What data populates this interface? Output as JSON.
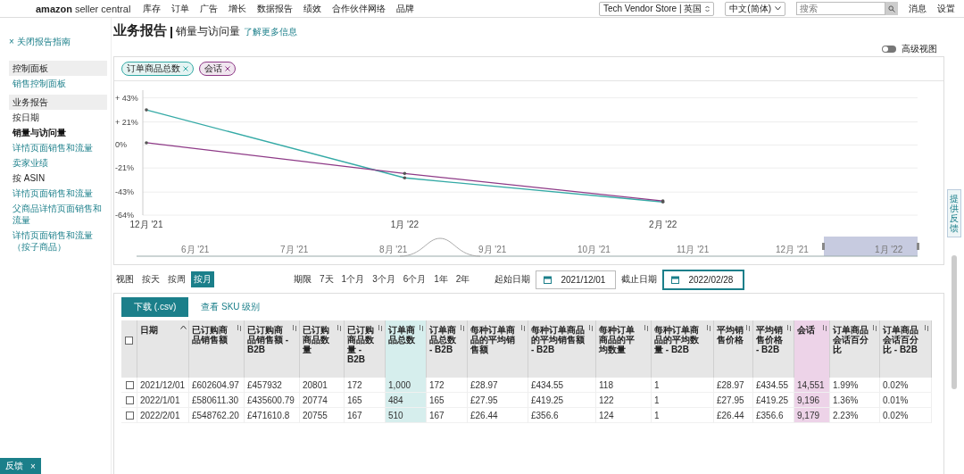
{
  "topbar": {
    "logo": {
      "brand": "amazon",
      "product": "seller central"
    },
    "nav": [
      "库存",
      "订单",
      "广告",
      "增长",
      "数据报告",
      "绩效",
      "合作伙伴网络",
      "品牌"
    ],
    "store": "Tech Vendor Store | 英国",
    "language": "中文(简体)",
    "search": {
      "placeholder": "搜索"
    },
    "links": [
      "消息",
      "设置"
    ]
  },
  "sidebar": {
    "close": "× 关闭报告指南",
    "items": [
      {
        "kind": "section",
        "label": "控制面板",
        "selected": false
      },
      {
        "kind": "link",
        "label": "销售控制面板",
        "selected": false
      },
      {
        "kind": "section",
        "label": "业务报告",
        "selected": false
      },
      {
        "kind": "group",
        "label": "按日期",
        "selected": false
      },
      {
        "kind": "link",
        "label": "销量与访问量",
        "selected": true
      },
      {
        "kind": "link",
        "label": "详情页面销售和流量",
        "selected": false
      },
      {
        "kind": "link",
        "label": "卖家业绩",
        "selected": false
      },
      {
        "kind": "group",
        "label": "按 ASIN",
        "selected": false
      },
      {
        "kind": "link",
        "label": "详情页面销售和流量",
        "selected": false
      },
      {
        "kind": "link",
        "label": "父商品详情页面销售和流量",
        "selected": false
      },
      {
        "kind": "link",
        "label": "详情页面销售和流量（按子商品）",
        "selected": false
      }
    ]
  },
  "header": {
    "title": "业务报告",
    "subtitle": "销量与访问量",
    "learn_more": "了解更多信息",
    "view_toggle": {
      "label": "高级视图",
      "on": false
    }
  },
  "chart": {
    "chart_data": {
      "type": "line",
      "grid": true,
      "categories": [
        "12月 '21",
        "1月 '22",
        "2月 '22"
      ],
      "series": [
        {
          "name": "订单商品总数",
          "color": "#35aaa6",
          "values": [
            32,
            -30,
            -52
          ]
        },
        {
          "name": "会话",
          "color": "#8e3a87",
          "values": [
            2,
            -26,
            -51
          ]
        }
      ],
      "ylim": [
        -64,
        50
      ],
      "yticks": [
        {
          "value": 43,
          "label": "+ 43%"
        },
        {
          "value": 21,
          "label": "+ 21%"
        },
        {
          "value": 0,
          "label": "0%"
        },
        {
          "value": -21,
          "label": "-21%"
        },
        {
          "value": -43,
          "label": "-43%"
        },
        {
          "value": -64,
          "label": "-64%"
        }
      ]
    },
    "navigator": {
      "labels": [
        "6月 '21",
        "7月 '21",
        "8月 '21",
        "9月 '21",
        "10月 '21",
        "11月 '21",
        "12月 '21",
        "1月 '22"
      ]
    }
  },
  "controls": {
    "view_label": "视图",
    "views": [
      {
        "label": "按天",
        "selected": false
      },
      {
        "label": "按周",
        "selected": false
      },
      {
        "label": "按月",
        "selected": true
      }
    ],
    "range_label": "期限",
    "ranges": [
      {
        "label": "7天",
        "selected": false
      },
      {
        "label": "1个月",
        "selected": false
      },
      {
        "label": "3个月",
        "selected": false
      },
      {
        "label": "6个月",
        "selected": false
      },
      {
        "label": "1年",
        "selected": false
      },
      {
        "label": "2年",
        "selected": false
      }
    ],
    "start_label": "起始日期",
    "start": "2021/12/01",
    "end_label": "截止日期",
    "end": "2022/02/28"
  },
  "table": {
    "download": "下载 (.csv)",
    "sku_link": "查看 SKU 级别",
    "header_checked": false,
    "columns": [
      {
        "label": "日期",
        "sorted": true
      },
      {
        "label": "已订购商品销售额",
        "sorted": false
      },
      {
        "label": "已订购商品销售额 - B2B",
        "sorted": false
      },
      {
        "label": "已订购商品数量",
        "sorted": false
      },
      {
        "label": "已订购商品数量 - B2B",
        "sorted": false
      },
      {
        "label": "订单商品总数",
        "sorted": false,
        "color": "#d6eeed"
      },
      {
        "label": "订单商品总数 - B2B",
        "sorted": false
      },
      {
        "label": "每种订单商品的平均销售额",
        "sorted": false
      },
      {
        "label": "每种订单商品的平均销售额 - B2B",
        "sorted": false
      },
      {
        "label": "每种订单商品的平均数量",
        "sorted": false
      },
      {
        "label": "每种订单商品的平均数量 - B2B",
        "sorted": false
      },
      {
        "label": "平均销售价格",
        "sorted": false
      },
      {
        "label": "平均销售价格 - B2B",
        "sorted": false
      },
      {
        "label": "会话",
        "sorted": false,
        "color": "#edd3e8"
      },
      {
        "label": "订单商品会话百分比",
        "sorted": false
      },
      {
        "label": "订单商品会话百分比 - B2B",
        "sorted": false
      }
    ],
    "rows": [
      {
        "selected": false,
        "cells": [
          "2021/12/01",
          "£602604.97",
          "£457932",
          "20801",
          "172",
          "1,000",
          "172",
          "£28.97",
          "£434.55",
          "118",
          "1",
          "£28.97",
          "£434.55",
          "14,551",
          "1.99%",
          "0.02%"
        ]
      },
      {
        "selected": false,
        "cells": [
          "2022/1/01",
          "£580611.30",
          "£435600.79",
          "20774",
          "165",
          "484",
          "165",
          "£27.95",
          "£419.25",
          "122",
          "1",
          "£27.95",
          "£419.25",
          "9,196",
          "1.36%",
          "0.01%"
        ]
      },
      {
        "selected": false,
        "cells": [
          "2022/2/01",
          "£548762.20",
          "£471610.8",
          "20755",
          "167",
          "510",
          "167",
          "£26.44",
          "£356.6",
          "124",
          "1",
          "£26.44",
          "£356.6",
          "9,179",
          "2.23%",
          "0.02%"
        ]
      }
    ]
  },
  "feedback": {
    "label": "反馈",
    "close": "×",
    "side_tab": "提供反馈"
  }
}
